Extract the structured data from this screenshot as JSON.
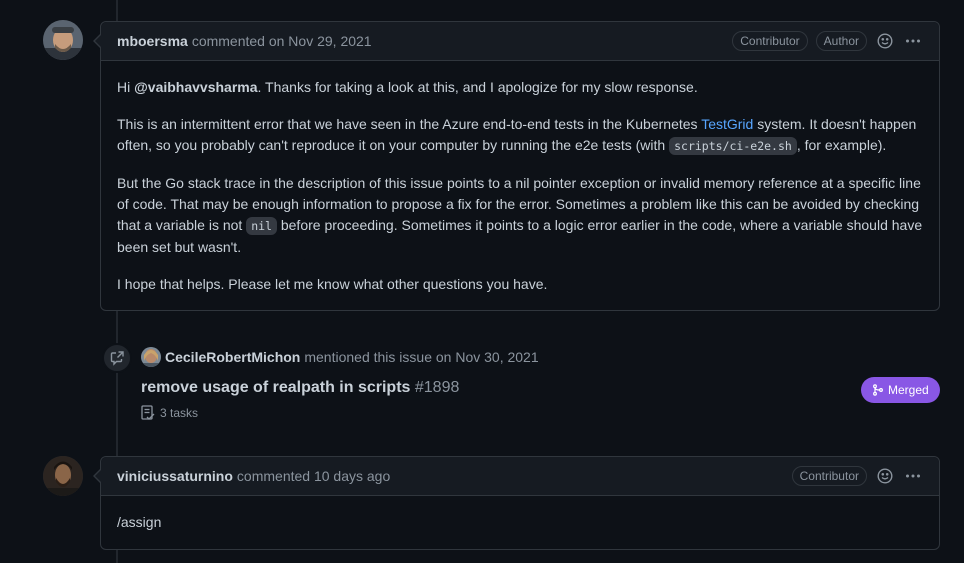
{
  "comment1": {
    "author": "mboersma",
    "meta": "commented on Nov 29, 2021",
    "badges": [
      "Contributor",
      "Author"
    ],
    "p1": {
      "a": "Hi ",
      "mention": "@vaibhavvsharma",
      "b": ". Thanks for taking a look at this, and I apologize for my slow response."
    },
    "p2": {
      "a": "This is an intermittent error that we have seen in the Azure end-to-end tests in the Kubernetes ",
      "link": "TestGrid",
      "b": " system. It doesn't happen often, so you probably can't reproduce it on your computer by running the e2e tests (with ",
      "code": "scripts/ci-e2e.sh",
      "c": ", for example)."
    },
    "p3": {
      "a": "But the Go stack trace in the description of this issue points to a nil pointer exception or invalid memory reference at a specific line of code. That may be enough information to propose a fix for the error. Sometimes a problem like this can be avoided by checking that a variable is not ",
      "code": "nil",
      "b": " before proceeding. Sometimes it points to a logic error earlier in the code, where a variable should have been set but wasn't."
    },
    "p4": "I hope that helps. Please let me know what other questions you have."
  },
  "event": {
    "author": "CecileRobertMichon",
    "meta": "mentioned this issue on Nov 30, 2021",
    "pr_title": "remove usage of realpath in scripts",
    "pr_number": "#1898",
    "tasks": "3 tasks",
    "status": "Merged",
    "status_color": "#8957e5"
  },
  "comment2": {
    "author": "viniciussaturnino",
    "meta": "commented 10 days ago",
    "badges": [
      "Contributor"
    ],
    "body": "/assign"
  },
  "icons": {
    "reaction": "smiley-icon",
    "more": "kebab-horizontal-icon",
    "cross_reference": "cross-reference-icon",
    "merge": "git-merge-icon",
    "tasklist": "tasklist-icon"
  }
}
